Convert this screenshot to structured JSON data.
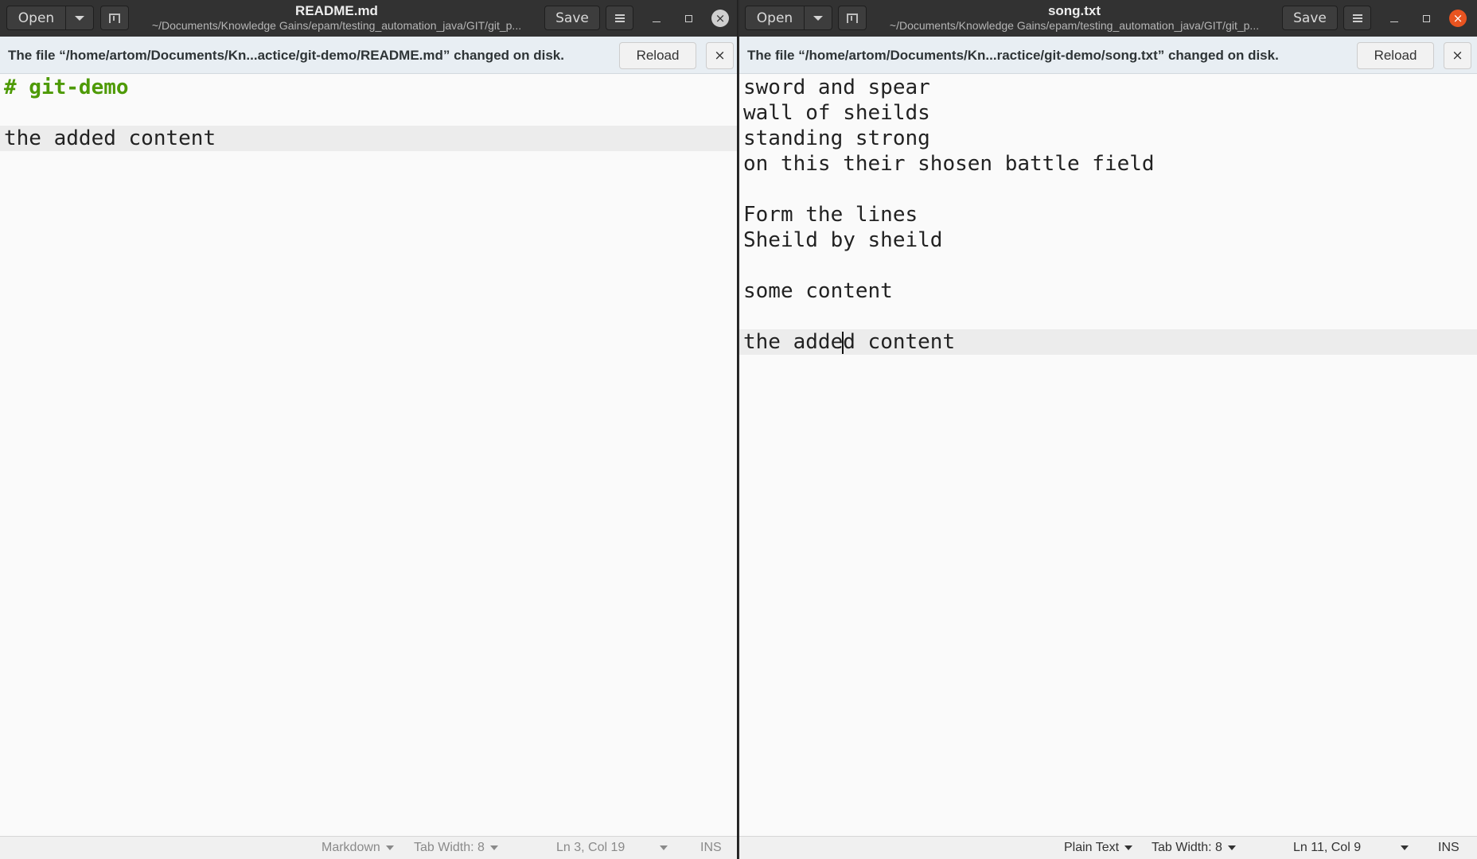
{
  "left_window": {
    "title": "README.md",
    "path": "~/Documents/Knowledge Gains/epam/testing_automation_java/GIT/git_p...",
    "open_label": "Open",
    "save_label": "Save",
    "close_glyph": "×",
    "infobar": {
      "message": "The file “/home/artom/Documents/Kn...actice/git-demo/README.md” changed on disk.",
      "reload_label": "Reload",
      "close_glyph": "×"
    },
    "lines": [
      "# git-demo",
      "",
      "the added content"
    ],
    "statusbar": {
      "language": "Markdown",
      "tab_width": "Tab Width: 8",
      "position": "Ln 3, Col 19",
      "mode": "INS"
    }
  },
  "right_window": {
    "title": "song.txt",
    "path": "~/Documents/Knowledge Gains/epam/testing_automation_java/GIT/git_p...",
    "open_label": "Open",
    "save_label": "Save",
    "close_glyph": "×",
    "infobar": {
      "message": "The file “/home/artom/Documents/Kn...ractice/git-demo/song.txt” changed on disk.",
      "reload_label": "Reload",
      "close_glyph": "×"
    },
    "lines": [
      "sword and spear",
      "wall of sheilds",
      "standing strong",
      "on this their shosen battle field",
      "",
      "Form the lines",
      "Sheild by sheild",
      "",
      "some content",
      "",
      "the added content"
    ],
    "statusbar": {
      "language": "Plain Text",
      "tab_width": "Tab Width: 8",
      "position": "Ln 11, Col 9",
      "mode": "INS"
    }
  },
  "colors": {
    "headerbar": "#323232",
    "infobar": "#e8eef3",
    "markdown_heading": "#4e9a06",
    "close_active": "#e95420"
  }
}
